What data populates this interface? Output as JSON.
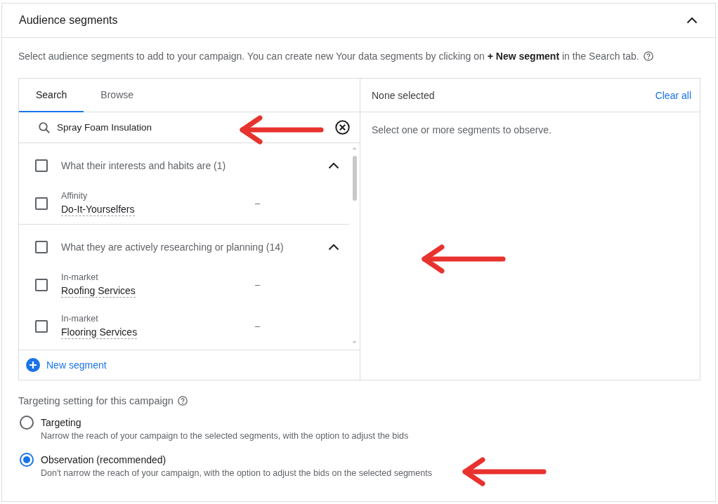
{
  "section": {
    "title": "Audience segments",
    "expanded": true,
    "description": "Select audience segments to add to your campaign. You can create new Your data segments by clicking on **+ New segment** in the Search tab."
  },
  "picker": {
    "tabs": [
      {
        "label": "Search",
        "selected": true
      },
      {
        "label": "Browse",
        "selected": false
      }
    ],
    "search": {
      "value": "Spray Foam Insulation"
    },
    "groups": [
      {
        "label": "What their interests and habits are (1)",
        "checked": false,
        "expanded": true,
        "items": [
          {
            "category": "Affinity",
            "name": "Do-It-Yourselfers",
            "column_2": "–",
            "checked": false
          }
        ]
      },
      {
        "label": "What they are actively researching or planning (14)",
        "checked": false,
        "expanded": true,
        "items": [
          {
            "category": "In-market",
            "name": "Roofing Services",
            "column_2": "–",
            "checked": false
          },
          {
            "category": "In-market",
            "name": "Flooring Services",
            "column_2": "–",
            "checked": false
          }
        ]
      }
    ],
    "new_segment": "New segment"
  },
  "selection": {
    "header": "None selected",
    "clear_all": "Clear all",
    "empty_text": "Select one or more segments to observe."
  },
  "targeting": {
    "title": "Targeting setting for this campaign",
    "options": [
      {
        "label": "Targeting",
        "description": "Narrow the reach of your campaign to the selected segments, with the option to adjust the bids",
        "selected": false
      },
      {
        "label": "Observation (recommended)",
        "description": "Don't narrow the reach of your campaign, with the option to adjust the bids on the selected segments",
        "selected": true
      }
    ]
  }
}
